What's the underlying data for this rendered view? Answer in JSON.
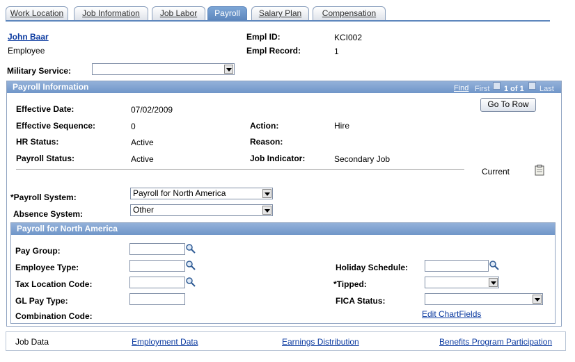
{
  "tabs": [
    "Work Location",
    "Job Information",
    "Job Labor",
    "Payroll",
    "Salary Plan",
    "Compensation"
  ],
  "active_tab": "Payroll",
  "employee": {
    "name": "John Baar",
    "role": "Employee"
  },
  "empl_id": {
    "label": "Empl ID:",
    "value": "KCI002"
  },
  "empl_record": {
    "label": "Empl Record:",
    "value": "1"
  },
  "military": {
    "label": "Military Service:",
    "value": ""
  },
  "payroll_info": {
    "title": "Payroll Information",
    "nav": {
      "find": "Find",
      "first": "First",
      "range": "1 of 1",
      "last": "Last"
    },
    "goto_button": "Go To Row",
    "effective_date": {
      "label": "Effective Date:",
      "value": "07/02/2009"
    },
    "effective_sequence": {
      "label": "Effective Sequence:",
      "value": "0"
    },
    "action": {
      "label": "Action:",
      "value": "Hire"
    },
    "hr_status": {
      "label": "HR Status:",
      "value": "Active"
    },
    "reason": {
      "label": "Reason:",
      "value": ""
    },
    "payroll_status": {
      "label": "Payroll Status:",
      "value": "Active"
    },
    "job_indicator": {
      "label": "Job Indicator:",
      "value": "Secondary Job"
    },
    "current": "Current",
    "payroll_system": {
      "label": "*Payroll System:",
      "value": "Payroll for North America"
    },
    "absence_system": {
      "label": "Absence System:",
      "value": "Other"
    }
  },
  "pna": {
    "title": "Payroll for North America",
    "pay_group": "Pay Group:",
    "employee_type": "Employee Type:",
    "tax_location": "Tax Location Code:",
    "gl_pay_type": "GL Pay Type:",
    "combination_code": "Combination Code:",
    "holiday_schedule": "Holiday Schedule:",
    "tipped": "*Tipped:",
    "fica_status": "FICA Status:",
    "edit_chartfields": "Edit ChartFields"
  },
  "footer": {
    "job_data": "Job Data",
    "employment_data": "Employment Data",
    "earnings_distribution": "Earnings Distribution",
    "benefits": "Benefits Program Participation"
  }
}
